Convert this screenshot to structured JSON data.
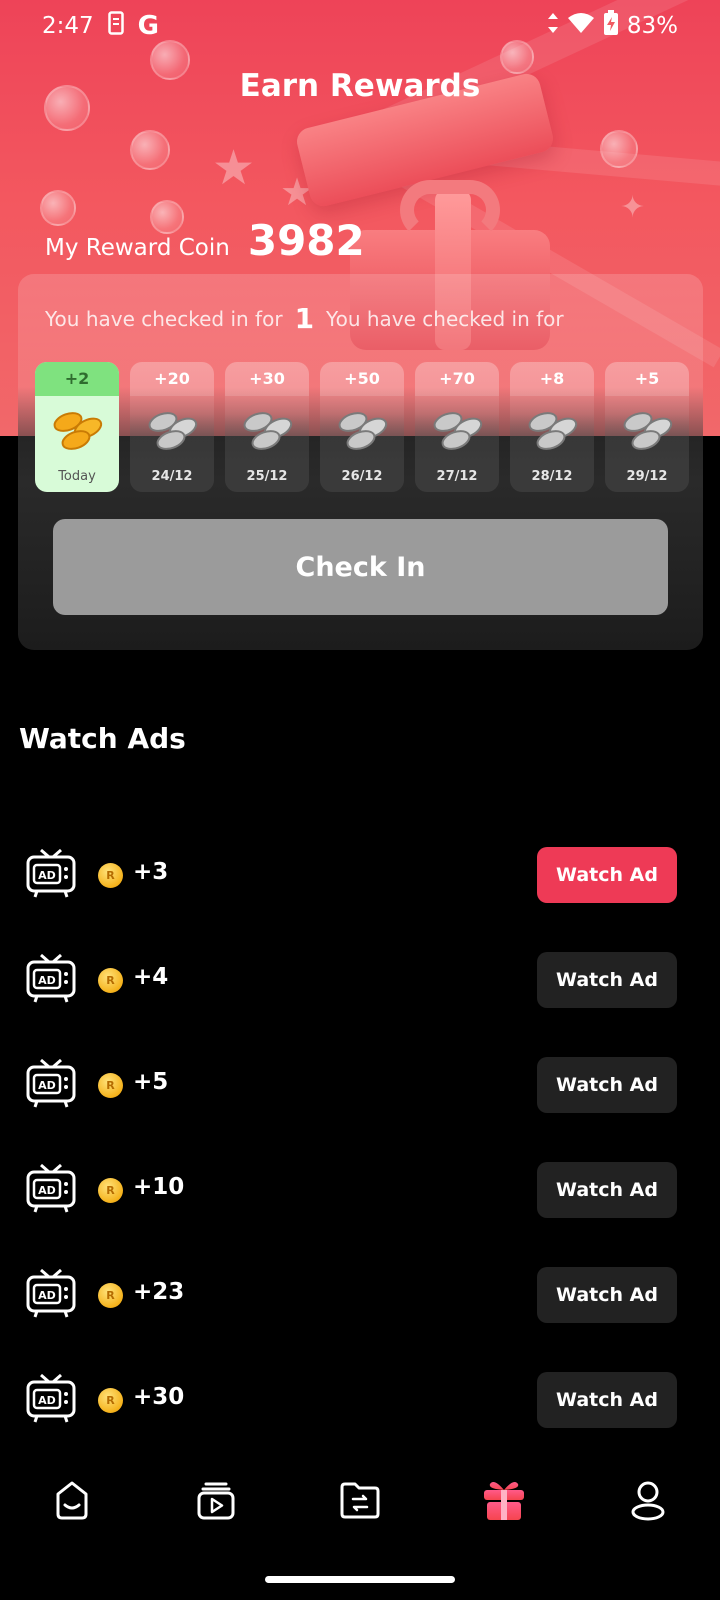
{
  "status_bar": {
    "time": "2:47",
    "carrier_letter": "G",
    "battery": "83%"
  },
  "page": {
    "title": "Earn Rewards"
  },
  "balance": {
    "label": "My Reward Coin",
    "value": "3982"
  },
  "checkin": {
    "text_before": "You have checked in for",
    "days": "1",
    "text_after": "You have checked in for",
    "button_label": "Check In",
    "days_list": [
      {
        "amount": "+2",
        "date": "Today",
        "state": "today"
      },
      {
        "amount": "+20",
        "date": "24/12",
        "state": "locked"
      },
      {
        "amount": "+30",
        "date": "25/12",
        "state": "locked"
      },
      {
        "amount": "+50",
        "date": "26/12",
        "state": "locked"
      },
      {
        "amount": "+70",
        "date": "27/12",
        "state": "locked"
      },
      {
        "amount": "+8",
        "date": "28/12",
        "state": "locked"
      },
      {
        "amount": "+5",
        "date": "29/12",
        "state": "locked"
      }
    ]
  },
  "watch_ads": {
    "title": "Watch Ads",
    "items": [
      {
        "reward": "+3",
        "button": "Watch Ad",
        "active": true
      },
      {
        "reward": "+4",
        "button": "Watch Ad",
        "active": false
      },
      {
        "reward": "+5",
        "button": "Watch Ad",
        "active": false
      },
      {
        "reward": "+10",
        "button": "Watch Ad",
        "active": false
      },
      {
        "reward": "+23",
        "button": "Watch Ad",
        "active": false
      },
      {
        "reward": "+30",
        "button": "Watch Ad",
        "active": false
      }
    ]
  },
  "bottom_nav": {
    "items": [
      {
        "icon": "home-face-icon",
        "active": false
      },
      {
        "icon": "videos-play-icon",
        "active": false
      },
      {
        "icon": "folder-transfer-icon",
        "active": false
      },
      {
        "icon": "gift-icon",
        "active": true
      },
      {
        "icon": "profile-icon",
        "active": false
      }
    ]
  },
  "colors": {
    "accent": "#ee3a56",
    "hero": "#f3575f",
    "today_green": "#7fe27f",
    "coin_gold": "#f5b21c"
  }
}
